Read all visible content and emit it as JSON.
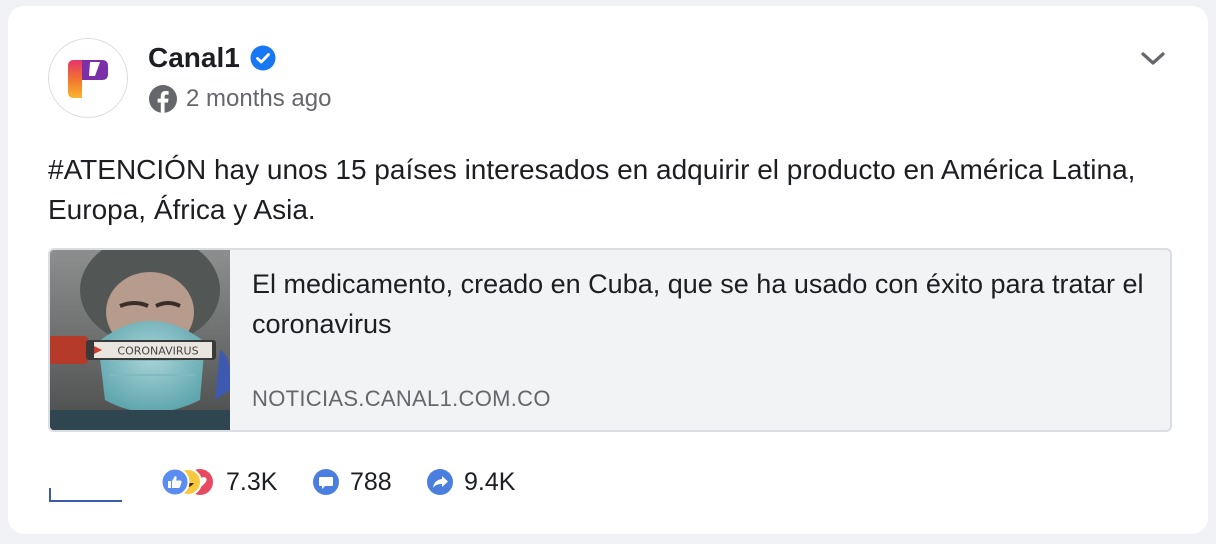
{
  "post": {
    "author": "Canal1",
    "time": "2 months ago",
    "text": "#ATENCIÓN hay unos 15 países interesados en adquirir el producto en América Latina, Europa, África y Asia.",
    "link": {
      "title": "El medicamento, creado en Cuba, que se ha usado con éxito para tratar el coronavirus",
      "domain": "NOTICIAS.CANAL1.COM.CO",
      "thumbnail_label": "CORONAVIRUS"
    }
  },
  "stats": {
    "reactions": "7.3K",
    "comments": "788",
    "shares": "9.4K"
  },
  "colors": {
    "verified": "#1877f2",
    "reaction_icon": "#5b8df0",
    "comment_icon": "#4a7fe0",
    "share_icon": "#4a7fe0"
  },
  "icons": [
    "canal1-logo-icon",
    "verified-icon",
    "facebook-icon",
    "chevron-down-icon",
    "like-icon",
    "haha-icon",
    "love-icon",
    "comment-icon",
    "share-icon"
  ]
}
